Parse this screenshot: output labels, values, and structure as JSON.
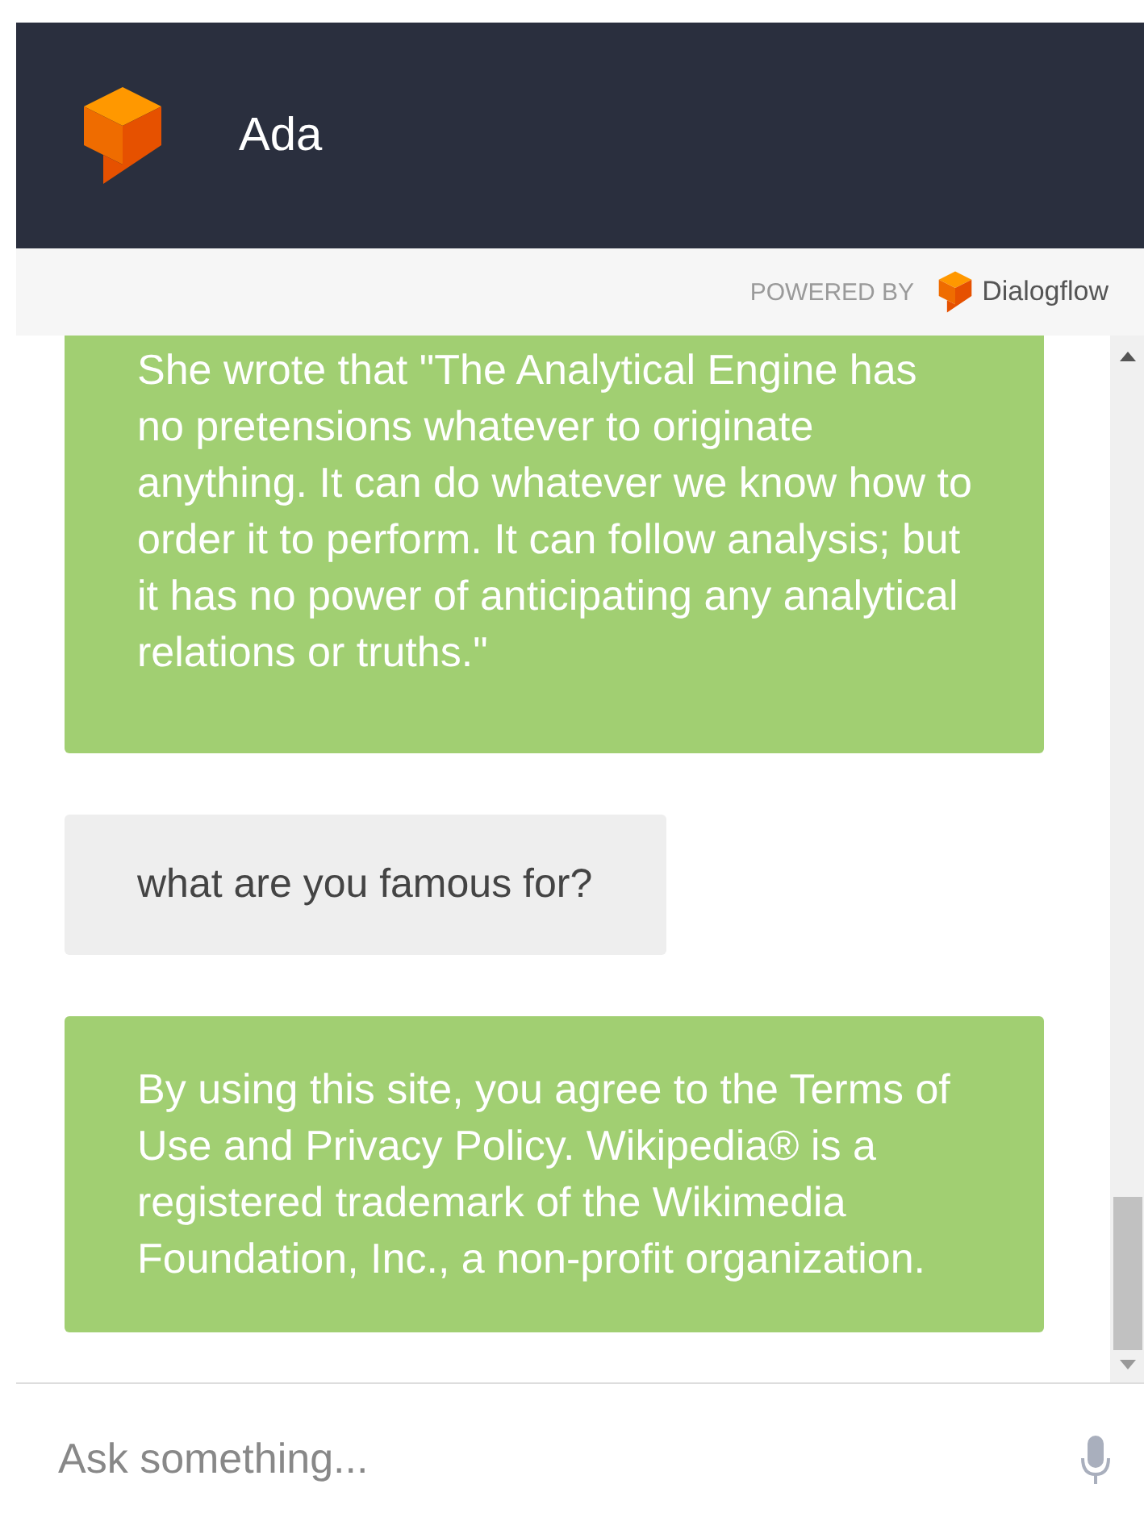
{
  "header": {
    "title": "Ada"
  },
  "powered_by": {
    "label": "POWERED BY",
    "brand": "Dialogflow"
  },
  "messages": [
    {
      "kind": "bot",
      "text": "She wrote that \"The Analytical Engine has no pretensions whatever to originate anything. It can do whatever we know how to order it to perform. It can follow analysis; but it has no power of anticipating any analytical relations or truths.\""
    },
    {
      "kind": "user",
      "text": "what are you famous for?"
    },
    {
      "kind": "bot",
      "text": "By using this site, you agree to the Terms of Use and Privacy Policy. Wikipedia® is a registered trademark of the Wikimedia Foundation, Inc., a non-profit organization."
    }
  ],
  "input": {
    "placeholder": "Ask something..."
  }
}
